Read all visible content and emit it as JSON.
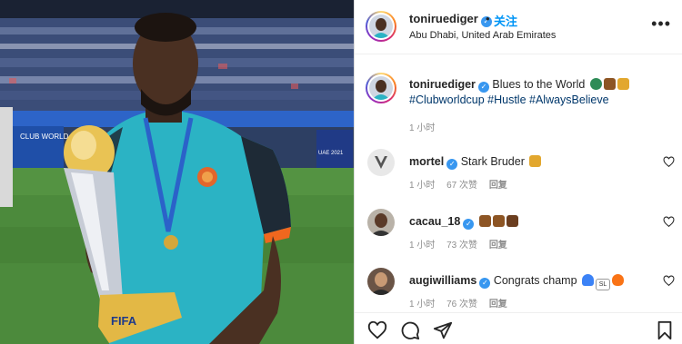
{
  "post": {
    "username": "toniruediger",
    "dot": "•",
    "follow_label": "关注",
    "location": "Abu Dhabi, United Arab Emirates",
    "more_icon": "more-horizontal-icon"
  },
  "caption": {
    "username": "toniruediger",
    "text": "Blues to the World",
    "hashtags": "#Clubworldcup #Hustle #AlwaysBelieve",
    "time": "1 小时",
    "emojis": [
      "globe-emoji",
      "praying-hands-emoji",
      "trophy-emoji"
    ]
  },
  "photo": {
    "trophy_label": "FIFA",
    "board_text": "CLUB WORLD CUP",
    "banner_text": "UAE 2021"
  },
  "comments": [
    {
      "username": "mortel",
      "text": "Stark Bruder",
      "emojis": [
        "trophy-emoji"
      ],
      "time": "1 小时",
      "likes": "67 次赞",
      "reply": "回复"
    },
    {
      "username": "cacau_18",
      "text": "",
      "emojis": [
        "praying-hands-emoji",
        "praying-hands-emoji",
        "fist-emoji"
      ],
      "time": "1 小时",
      "likes": "73 次赞",
      "reply": "回复"
    },
    {
      "username": "augiwilliams",
      "text": "Congrats champ",
      "emojis": [
        "blue-heart-emoji",
        "sl-emoji",
        "fire-emoji"
      ],
      "time": "1 小时",
      "likes": "76 次赞",
      "reply": "回复"
    }
  ],
  "actions": [
    "like-icon",
    "comment-icon",
    "share-icon",
    "save-icon"
  ],
  "colors": {
    "accent": "#0095f6",
    "verified": "#3897f0",
    "hashtag": "#00376b",
    "muted": "#8e8e8e",
    "shirt": "#2bb3c4"
  }
}
